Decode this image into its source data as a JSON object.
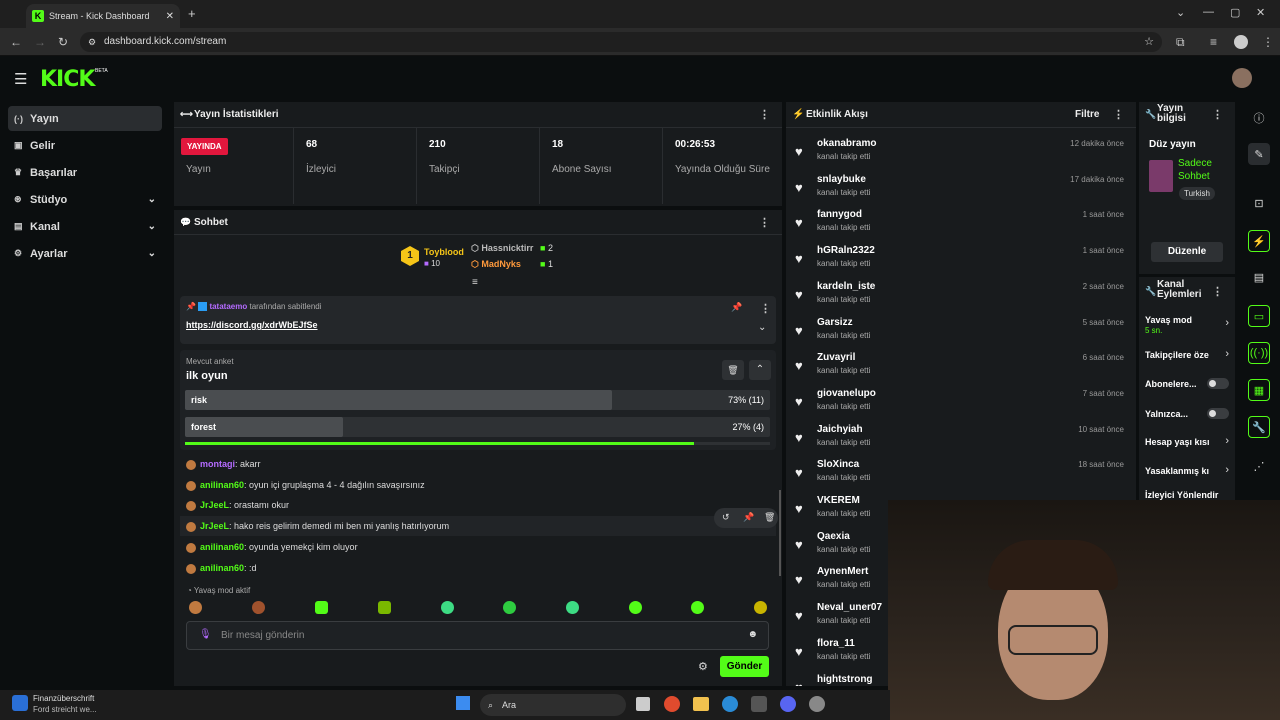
{
  "browser": {
    "tab_title": "Stream - Kick Dashboard",
    "url": "dashboard.kick.com/stream"
  },
  "brand": {
    "logo": "KICK",
    "beta": "BETA",
    "accent": "#53fc18"
  },
  "sidebar": {
    "items": [
      {
        "label": "Yayın",
        "icon": "broadcast-icon"
      },
      {
        "label": "Gelir",
        "icon": "wallet-icon"
      },
      {
        "label": "Başarılar",
        "icon": "trophy-icon"
      },
      {
        "label": "Stüdyo",
        "icon": "studio-icon"
      },
      {
        "label": "Kanal",
        "icon": "channel-icon"
      },
      {
        "label": "Ayarlar",
        "icon": "gear-icon"
      }
    ]
  },
  "stats": {
    "title": "Yayın İstatistikleri",
    "live_badge": "YAYINDA",
    "live_label": "Yayın",
    "viewers_value": "68",
    "viewers_label": "İzleyici",
    "followers_value": "210",
    "followers_label": "Takipçi",
    "subs_value": "18",
    "subs_label": "Abone Sayısı",
    "uptime_value": "00:26:53",
    "uptime_label": "Yayında Olduğu Süre"
  },
  "chat": {
    "title": "Sohbet",
    "leader": {
      "rank": "1",
      "name": "Toyblood",
      "count": "10"
    },
    "leader2": {
      "name": "Hassnicktirr",
      "count": "2"
    },
    "leader3": {
      "name": "MadNyks",
      "count": "1"
    },
    "pinned_by": "tatataemo",
    "pinned_suffix": "tarafından sabitlendi",
    "pinned_link": "https://discord.gg/xdrWbEJfSe",
    "poll": {
      "label": "Mevcut anket",
      "title": "ilk oyun",
      "options": [
        {
          "name": "risk",
          "result": "73% (11)",
          "fraction": 0.73
        },
        {
          "name": "forest",
          "result": "27% (4)",
          "fraction": 0.27
        }
      ],
      "time_remaining_fraction": 0.87
    },
    "messages": [
      {
        "user": "montagi",
        "text": ": akarr"
      },
      {
        "user": "anilinan60",
        "text": ": oyun içi gruplaşma 4 - 4 dağılın savaşırsınız"
      },
      {
        "user": "JrJeeL",
        "text": ": orastamı okur"
      },
      {
        "user": "JrJeeL",
        "text": ": hako reis gelirim demedi mi ben mi yanlış hatırlıyorum"
      },
      {
        "user": "anilinan60",
        "text": ": oyunda yemekçi kim oluyor"
      },
      {
        "user": "anilinan60",
        "text": ": :d"
      }
    ],
    "slow_mode": "Yavaş mod aktif",
    "input_placeholder": "Bir mesaj gönderin",
    "send_label": "Gönder"
  },
  "events": {
    "title": "Etkinlik Akışı",
    "filter_label": "Filtre",
    "items": [
      {
        "name": "okanabramo",
        "sub": "kanalı takip etti",
        "time": "12 dakika önce"
      },
      {
        "name": "snlaybuke",
        "sub": "kanalı takip etti",
        "time": "17 dakika önce"
      },
      {
        "name": "fannygod",
        "sub": "kanalı takip etti",
        "time": "1 saat önce"
      },
      {
        "name": "hGRaln2322",
        "sub": "kanalı takip etti",
        "time": "1 saat önce"
      },
      {
        "name": "kardeln_iste",
        "sub": "kanalı takip etti",
        "time": "2 saat önce"
      },
      {
        "name": "Garsizz",
        "sub": "kanalı takip etti",
        "time": "5 saat önce"
      },
      {
        "name": "Zuvayril",
        "sub": "kanalı takip etti",
        "time": "6 saat önce"
      },
      {
        "name": "giovanelupo",
        "sub": "kanalı takip etti",
        "time": "7 saat önce"
      },
      {
        "name": "Jaichyiah",
        "sub": "kanalı takip etti",
        "time": "10 saat önce"
      },
      {
        "name": "SloXinca",
        "sub": "kanalı takip etti",
        "time": "18 saat önce"
      },
      {
        "name": "VKEREM",
        "sub": "kanalı takip etti",
        "time": ""
      },
      {
        "name": "Qaexia",
        "sub": "kanalı takip etti",
        "time": ""
      },
      {
        "name": "AynenMert",
        "sub": "kanalı takip etti",
        "time": ""
      },
      {
        "name": "Neval_uner07",
        "sub": "kanalı takip etti",
        "time": ""
      },
      {
        "name": "flora_11",
        "sub": "kanalı takip etti",
        "time": ""
      },
      {
        "name": "hightstrong",
        "sub": "",
        "time": ""
      }
    ]
  },
  "info": {
    "title": "Yayın bilgisi",
    "edit_heading": "Düz yayın",
    "category": "Sadece Sohbet",
    "tag": "Turkish",
    "edit_button": "Düzenle"
  },
  "actions": {
    "title": "Kanal Eylemleri",
    "slow_mode": "Yavaş mod",
    "slow_mode_value": "5 sn.",
    "followers_only": "Takipçilere öze",
    "subs_only": "Abonelere...",
    "emotes_only": "Yalnızca...",
    "account_age": "Hesap yaşı kısı",
    "banned_words": "Yasaklanmış kı",
    "viewer_redirect": "İzleyici Yönlendir"
  },
  "taskbar": {
    "widget_title": "Finanzüberschrift",
    "widget_sub": "Ford streicht we...",
    "search": "Ara"
  }
}
